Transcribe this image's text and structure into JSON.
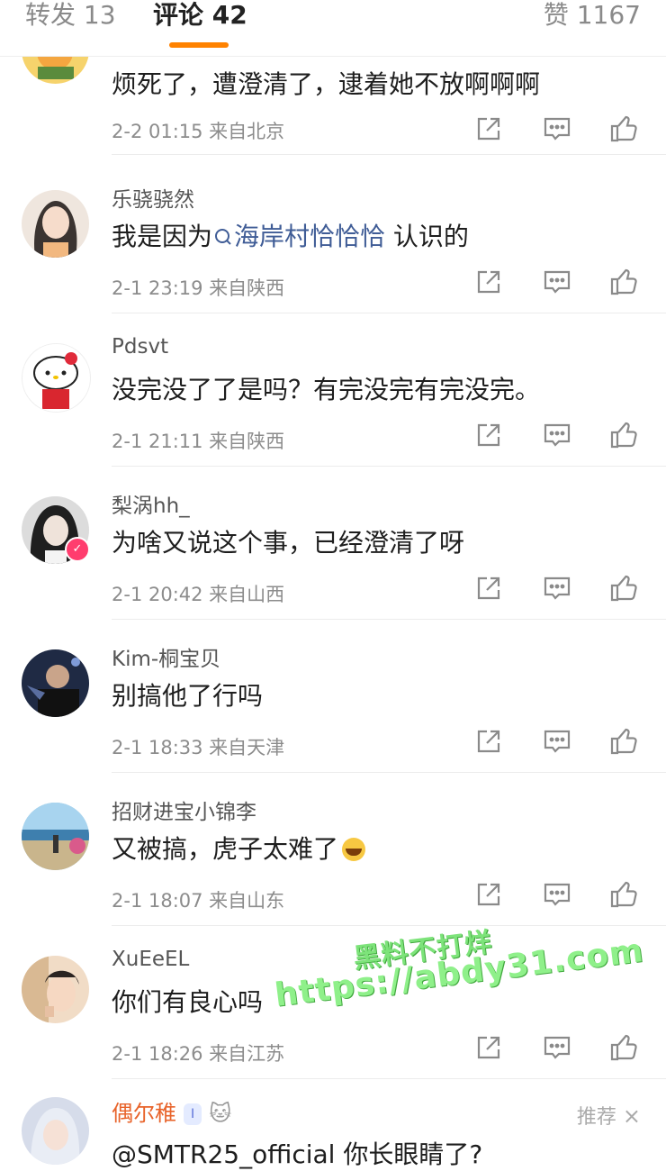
{
  "tabs": {
    "repost": "转发 13",
    "comments": "评论 42",
    "likes": "赞 1167"
  },
  "comments": [
    {
      "username": "",
      "text": "烦死了，遭澄清了，逮着她不放啊啊啊",
      "meta": "2-2 01:15 来自北京",
      "avatar_color": "#f2c14e"
    },
    {
      "username": "乐骁骁然",
      "text_prefix": "我是因为",
      "search_link": "海岸村恰恰恰",
      "text_suffix": " 认识的",
      "meta": "2-1 23:19 来自陕西",
      "avatar_color": "#e8dcd3"
    },
    {
      "username": "Pdsvt",
      "text": "没完没了了是吗？有完没完有完没完。",
      "meta": "2-1 21:11 来自陕西",
      "avatar_color": "#fdfdfd"
    },
    {
      "username": "梨涡hh_",
      "text": "为啥又说这个事，已经澄清了呀",
      "meta": "2-1 20:42 来自山西",
      "avatar_color": "#d9d9d9"
    },
    {
      "username": "Kim-桐宝贝",
      "text": "别搞他了行吗",
      "meta": "2-1 18:33 来自天津",
      "avatar_color": "#1f2a44"
    },
    {
      "username": "招财进宝小锦李",
      "text": "又被搞，虎子太难了",
      "meta": "2-1 18:07 来自山东",
      "avatar_color": "#6fa8c8"
    },
    {
      "username": "XuEeEL",
      "text": "你们有良心吗",
      "meta": "2-1 18:26 来自江苏",
      "avatar_color": "#e9c9a8"
    },
    {
      "username": "偶尔稚",
      "badge": "I",
      "recommend": "推荐",
      "text": "@SMTR25_official 你长眼睛了?",
      "avatar_color": "#cfd6e6"
    }
  ],
  "watermark": {
    "line1": "黑料不打烊",
    "line2": "https://abdy31.com"
  },
  "colors": {
    "accent": "#ff8200",
    "link": "#3f5c96",
    "meta": "#8c8c8c"
  }
}
